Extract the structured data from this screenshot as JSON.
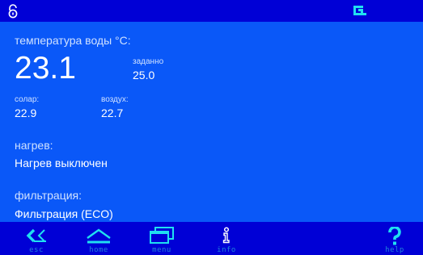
{
  "status": {
    "lock_icon": "lock-open-icon",
    "connection_icon": "connection-icon"
  },
  "water": {
    "label": "температура воды °C:",
    "temperature": "23.1",
    "setpoint_label": "заданно",
    "setpoint_value": "25.0"
  },
  "sensors": {
    "solar_label": "солар:",
    "solar_value": "22.9",
    "air_label": "воздух:",
    "air_value": "22.7"
  },
  "heating": {
    "label": "нагрев:",
    "value": "Нагрев выключен"
  },
  "filtration": {
    "label": "фильтрация:",
    "value": "Фильтрация (ECO)"
  },
  "nav": {
    "esc": "esc",
    "home": "home",
    "menu": "menu",
    "info": "info",
    "help": "help"
  },
  "colors": {
    "background": "#0a58f8",
    "bars": "#0000d6",
    "icon_cyan": "#20e0f0",
    "label_blue": "#1f84d8"
  }
}
